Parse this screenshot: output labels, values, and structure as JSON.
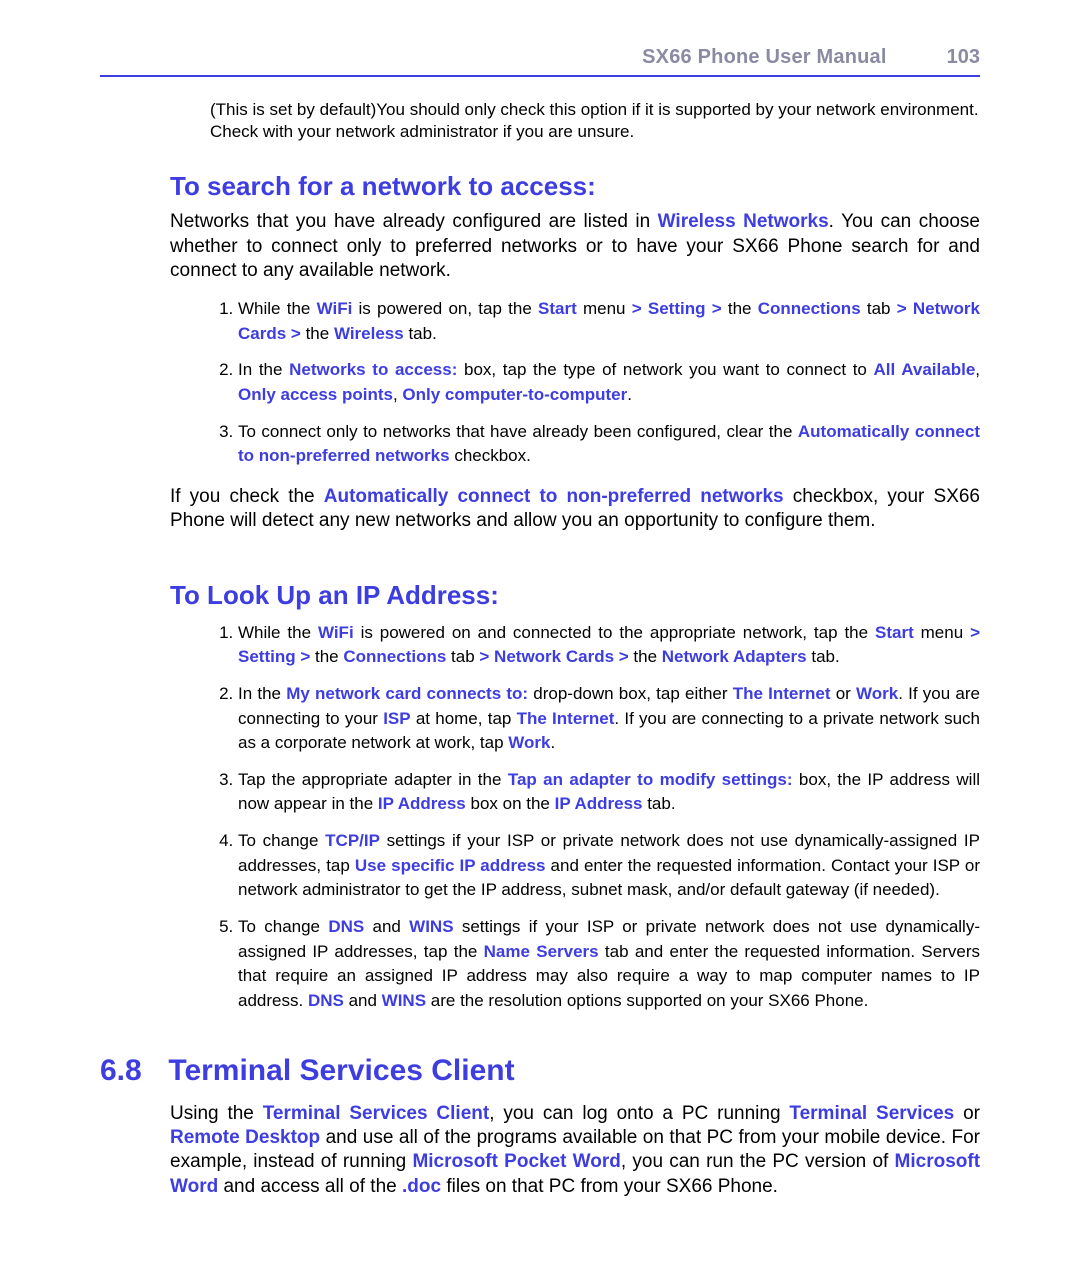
{
  "header": {
    "title": "SX66 Phone User Manual",
    "page": "103"
  },
  "intro_note": {
    "t1": "(This is set by default)You should only check this option if it is supported by your network environment. Check with your network administrator if you are unsure."
  },
  "section_search": {
    "heading": "To search for a network to access:",
    "para": {
      "pre": "Networks that you have already configured are listed in ",
      "kw1": "Wireless Networks",
      "post": ". You can choose whether to connect only to preferred networks or to have your SX66 Phone search for and connect to any available network."
    },
    "steps": {
      "s1": {
        "t1": "While the ",
        "kw_wifi": "WiFi",
        "t2": " is powered on, tap the ",
        "kw_start": "Start",
        "t3": " menu ",
        "path1": "> Setting >",
        "t4": " the ",
        "kw_conn": "Connections",
        "t5": " tab ",
        "gt1": ">",
        "t6": " ",
        "kw_nc": "Network Cards >",
        "t7": " the ",
        "kw_wireless": "Wireless",
        "t8": " tab."
      },
      "s2": {
        "t1": "In the ",
        "kw_nta": "Networks to access:",
        "t2": " box, tap the type of network you want to connect to ",
        "kw_aa": "All Available",
        "comma1": ", ",
        "kw_oap": "Only access points",
        "comma2": ", ",
        "kw_oc2c": "Only computer-to-computer",
        "period": "."
      },
      "s3": {
        "t1": "To connect only to networks that have already been configured, clear the ",
        "kw_auto": "Automatically connect to non-preferred networks",
        "t2": " checkbox."
      }
    },
    "para2": {
      "t1": "If you check the ",
      "kw_auto": "Automatically connect to non-preferred networks",
      "t2": " checkbox, your SX66 Phone will detect any new networks and allow you an opportunity to configure them."
    }
  },
  "section_ip": {
    "heading": "To Look Up an IP Address:",
    "steps": {
      "s1": {
        "t1": "While the ",
        "kw_wifi": "WiFi",
        "t2": " is powered on and connected to the appropriate network, tap the ",
        "kw_start": "Start",
        "t3": " menu ",
        "path1": "> Setting >",
        "t4": " the ",
        "kw_conn": "Connections",
        "t5": " tab ",
        "gt1": "> Network Cards >",
        "t6": " the ",
        "kw_na": "Network Adapters",
        "t7": " tab."
      },
      "s2": {
        "t1": "In the ",
        "kw_mnc": "My network card connects to:",
        "t2": " drop-down box, tap either ",
        "kw_inet1": "The Internet",
        "t3": " or ",
        "kw_work1": "Work",
        "t4": ". If you are connecting to your ",
        "kw_isp": "ISP",
        "t5": " at home, tap ",
        "kw_inet2": "The Internet",
        "t6": ". If you are connecting to a private network such as a corporate network at work, tap ",
        "kw_work2": "Work",
        "t7": "."
      },
      "s3": {
        "t1": "Tap the appropriate adapter in the ",
        "kw_tap": "Tap an adapter to modify settings:",
        "t2": "box, the IP address will now appear in the ",
        "kw_ipa1": "IP Address",
        "t3": " box on the ",
        "kw_ipa2": "IP Address",
        "t4": " tab."
      },
      "s4": {
        "t1": "To change ",
        "kw_tcpip": "TCP/IP",
        "t2": " settings if your ISP or private network does not use dynamically-assigned IP addresses, tap ",
        "kw_use": "Use specific IP address",
        "t3": " and enter the requested information. Contact your ISP or network administrator to get the IP address, subnet mask, and/or default gateway (if needed)."
      },
      "s5": {
        "t1": "To change ",
        "kw_dns1": "DNS",
        "t2": " and ",
        "kw_wins1": "WINS",
        "t3": " settings if your ISP or private network does not use dynamically-assigned IP addresses, tap the ",
        "kw_ns": "Name Servers",
        "t4": " tab and enter the requested information. Servers that require an assigned IP address may also require a way to map computer names to IP address. ",
        "kw_dns2": "DNS",
        "t5": " and ",
        "kw_wins2": "WINS",
        "t6": " are the resolution options supported on your SX66 Phone."
      }
    }
  },
  "section_tsc": {
    "number": "6.8",
    "title": "Terminal Services Client",
    "para": {
      "t1": "Using the ",
      "kw_tsc": "Terminal Services Client",
      "t2": ", you can log onto a PC running ",
      "kw_ts": "Terminal Services",
      "t3": " or ",
      "kw_rd": "Remote Desktop",
      "t4": " and use all of the programs available on that PC from your mobile device. For example, instead of running ",
      "kw_mpw": "Microsoft Pocket Word",
      "t5": ", you can run the PC version of ",
      "kw_mw": "Microsoft Word",
      "t6": " and access all of the ",
      "kw_doc": ".doc",
      "t7": " files on that PC from your SX66 Phone."
    }
  }
}
